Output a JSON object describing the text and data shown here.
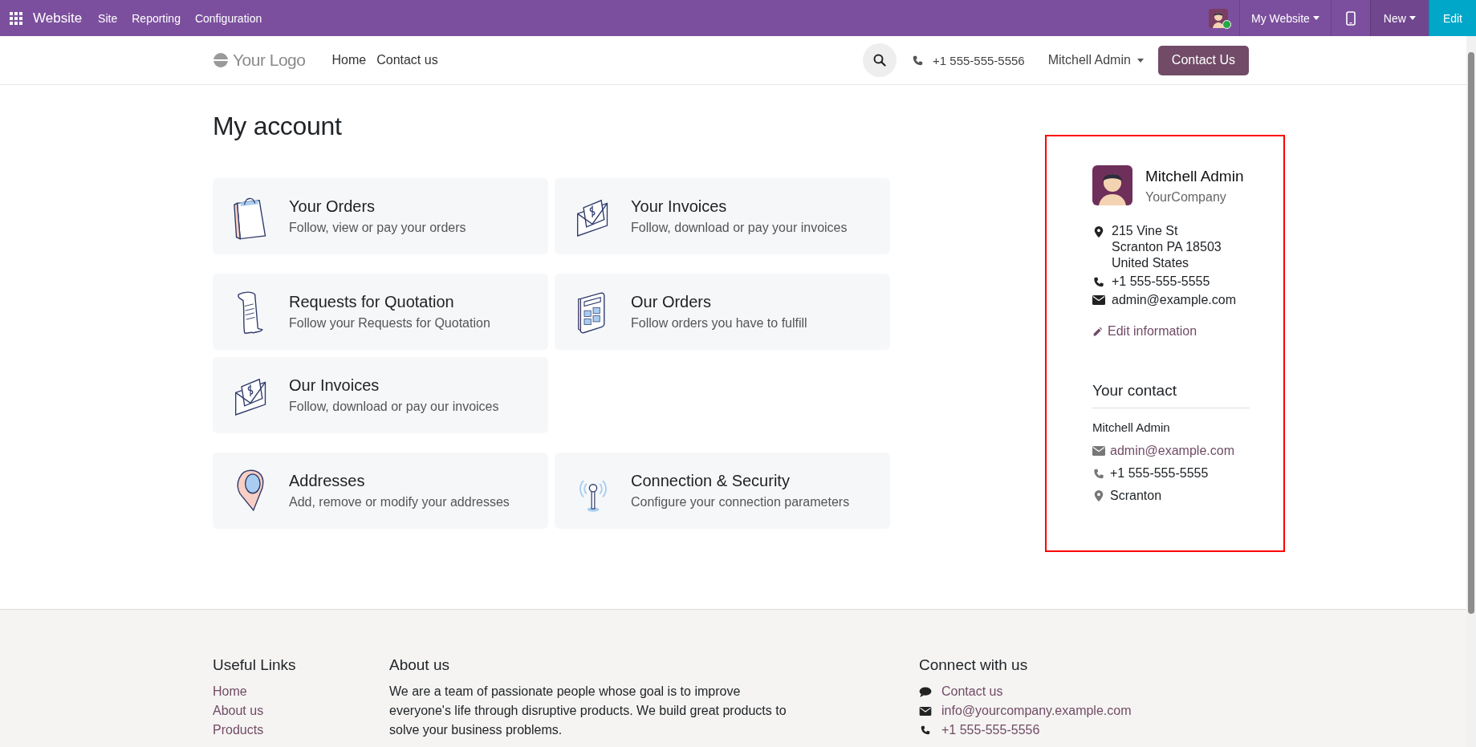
{
  "topbar": {
    "app": "Website",
    "menu": [
      "Site",
      "Reporting",
      "Configuration"
    ],
    "user_online": true,
    "website_menu": "My Website",
    "new_label": "New",
    "edit_label": "Edit"
  },
  "header": {
    "logo": "Your Logo",
    "nav": [
      "Home",
      "Contact us"
    ],
    "phone": "+1 555-555-5556",
    "user": "Mitchell Admin",
    "cta": "Contact Us"
  },
  "title": "My account",
  "card_groups": [
    [
      {
        "kind": "bag",
        "title": "Your Orders",
        "subtitle": "Follow, view or pay your orders"
      },
      {
        "kind": "envelope",
        "title": "Your Invoices",
        "subtitle": "Follow, download or pay your invoices"
      }
    ],
    [
      {
        "kind": "receipt",
        "title": "Requests for Quotation",
        "subtitle": "Follow your Requests for Quotation"
      },
      {
        "kind": "calculator",
        "title": "Our Orders",
        "subtitle": "Follow orders you have to fulfill"
      },
      {
        "kind": "envelope",
        "title": "Our Invoices",
        "subtitle": "Follow, download or pay our invoices"
      }
    ],
    [
      {
        "kind": "pin",
        "title": "Addresses",
        "subtitle": "Add, remove or modify your addresses"
      },
      {
        "kind": "antenna",
        "title": "Connection & Security",
        "subtitle": "Configure your connection parameters"
      }
    ]
  ],
  "profile": {
    "name": "Mitchell Admin",
    "company": "YourCompany",
    "details": [
      {
        "kind": "address",
        "lines": [
          "215 Vine St",
          "Scranton PA 18503",
          "United States"
        ]
      },
      {
        "kind": "phone",
        "lines": [
          "+1 555-555-5555"
        ]
      },
      {
        "kind": "email",
        "lines": [
          "admin@example.com"
        ]
      }
    ],
    "edit_link": "Edit information"
  },
  "contact": {
    "heading": "Your contact",
    "name": "Mitchell Admin",
    "details": [
      {
        "kind": "email",
        "text": "admin@example.com"
      },
      {
        "kind": "phone",
        "text": "+1 555-555-5555"
      },
      {
        "kind": "address",
        "text": "Scranton"
      }
    ]
  },
  "footer": {
    "links_heading": "Useful Links",
    "links": [
      "Home",
      "About us",
      "Products"
    ],
    "about_heading": "About us",
    "about_text": "We are a team of passionate people whose goal is to improve everyone's life through disruptive products. We build great products to solve your business problems.",
    "connect_heading": "Connect with us",
    "connect": [
      {
        "kind": "chat",
        "text": "Contact us"
      },
      {
        "kind": "email",
        "text": "info@yourcompany.example.com"
      },
      {
        "kind": "phone",
        "text": "+1 555-555-5556"
      }
    ]
  }
}
